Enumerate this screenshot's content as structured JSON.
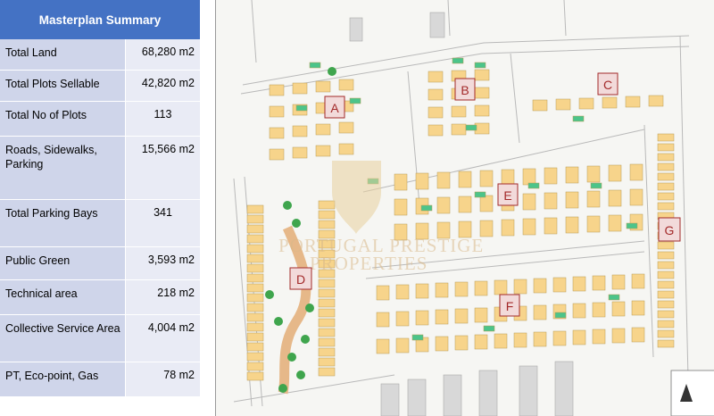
{
  "summary": {
    "title": "Masterplan Summary",
    "rows": [
      {
        "label": "Total Land",
        "value": "68,280 m2"
      },
      {
        "label": "Total Plots Sellable",
        "value": "42,820 m2"
      },
      {
        "label": "Total No of Plots",
        "value": "113"
      },
      {
        "label": "Roads, Sidewalks, Parking",
        "value": "15,566 m2"
      },
      {
        "label": "Total Parking Bays",
        "value": "341"
      },
      {
        "label": "Public Green",
        "value": "3,593 m2"
      },
      {
        "label": "Technical area",
        "value": "218 m2"
      },
      {
        "label": "Collective Service Area",
        "value": "4,004 m2"
      },
      {
        "label": "PT, Eco-point, Gas",
        "value": "78 m2"
      }
    ]
  },
  "plan": {
    "zones": [
      "A",
      "B",
      "C",
      "D",
      "E",
      "F",
      "G"
    ],
    "watermark_line1": "PORTUGAL PRESTIGE",
    "watermark_line2": "PROPERTIES",
    "colors": {
      "plot": "#f7d48b",
      "green": "#4cc48a",
      "zone_box": "#f2dada",
      "zone_text": "#a32a2a"
    }
  }
}
